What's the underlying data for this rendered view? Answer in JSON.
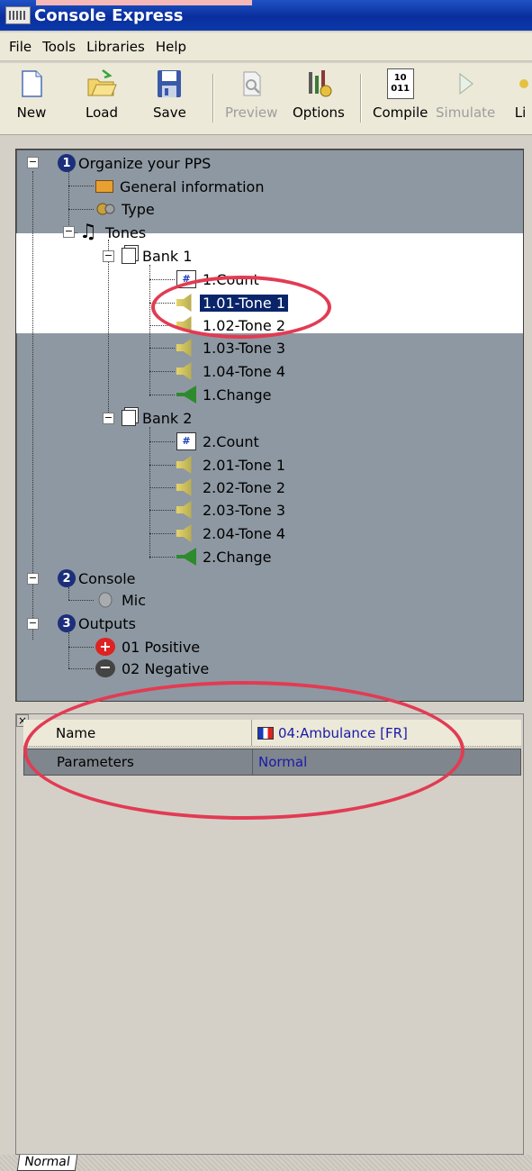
{
  "window": {
    "title": "Console Express"
  },
  "menu": [
    "File",
    "Tools",
    "Libraries",
    "Help"
  ],
  "toolbar": {
    "new": "New",
    "load": "Load",
    "save": "Save",
    "preview": "Preview",
    "options": "Options",
    "compile": "Compile",
    "simulate": "Simulate",
    "list_partial": "Li",
    "compile_icon_text": "10\n011"
  },
  "tree": {
    "organize": {
      "num": "1",
      "label": "Organize your PPS"
    },
    "general": "General information",
    "type": "Type",
    "tones": "Tones",
    "bank1": {
      "label": "Bank 1",
      "items": [
        "1.Count",
        "1.01-Tone 1",
        "1.02-Tone 2",
        "1.03-Tone 3",
        "1.04-Tone 4",
        "1.Change"
      ]
    },
    "bank2": {
      "label": "Bank 2",
      "items": [
        "2.Count",
        "2.01-Tone 1",
        "2.02-Tone 2",
        "2.03-Tone 3",
        "2.04-Tone 4",
        "2.Change"
      ]
    },
    "console": {
      "num": "2",
      "label": "Console"
    },
    "mic": "Mic",
    "outputs": {
      "num": "3",
      "label": "Outputs"
    },
    "positive": "01 Positive",
    "negative": "02 Negative",
    "selected": "1.01-Tone 1"
  },
  "properties": {
    "close": "×",
    "rows": [
      {
        "key": "Name",
        "value": "04:Ambulance [FR]"
      },
      {
        "key": "Parameters",
        "value": "Normal"
      }
    ]
  },
  "tabs": {
    "active": "Normal"
  },
  "colors": {
    "annotation": "#e23b53",
    "tree_bg": "#8e98a2",
    "selection": "#0a246a",
    "title": "#0a2e9e"
  }
}
